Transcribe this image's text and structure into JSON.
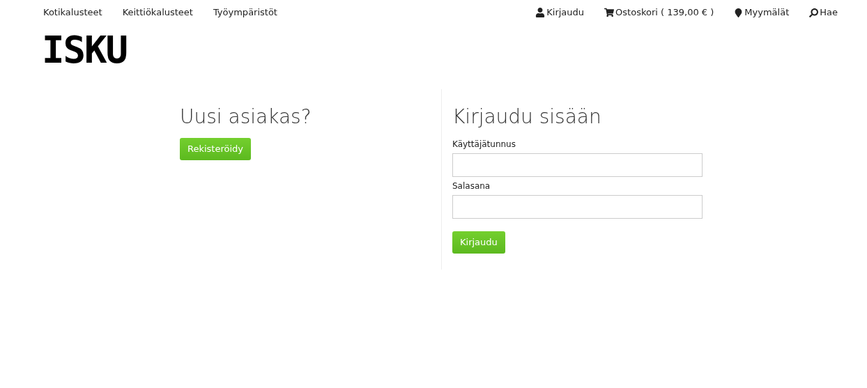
{
  "top_nav": {
    "categories": [
      {
        "label": "Kotikalusteet"
      },
      {
        "label": "Keittiökalusteet"
      },
      {
        "label": "Työympäristöt"
      }
    ],
    "utility_links": [
      {
        "kind": "user",
        "label": "Kirjaudu"
      },
      {
        "kind": "cart",
        "label": "Ostoskori ( 139,00 € )"
      },
      {
        "kind": "pin",
        "label": "Myymälät"
      },
      {
        "kind": "search",
        "label": "Hae"
      }
    ]
  },
  "logo": "ISKU",
  "new_customer": {
    "heading": "Uusi asiakas?",
    "button": "Rekisteröidy"
  },
  "login": {
    "heading": "Kirjaudu sisään",
    "fields": [
      {
        "label": "Käyttäjätunnus"
      },
      {
        "label": "Salasana"
      }
    ],
    "button": "Kirjaudu"
  }
}
